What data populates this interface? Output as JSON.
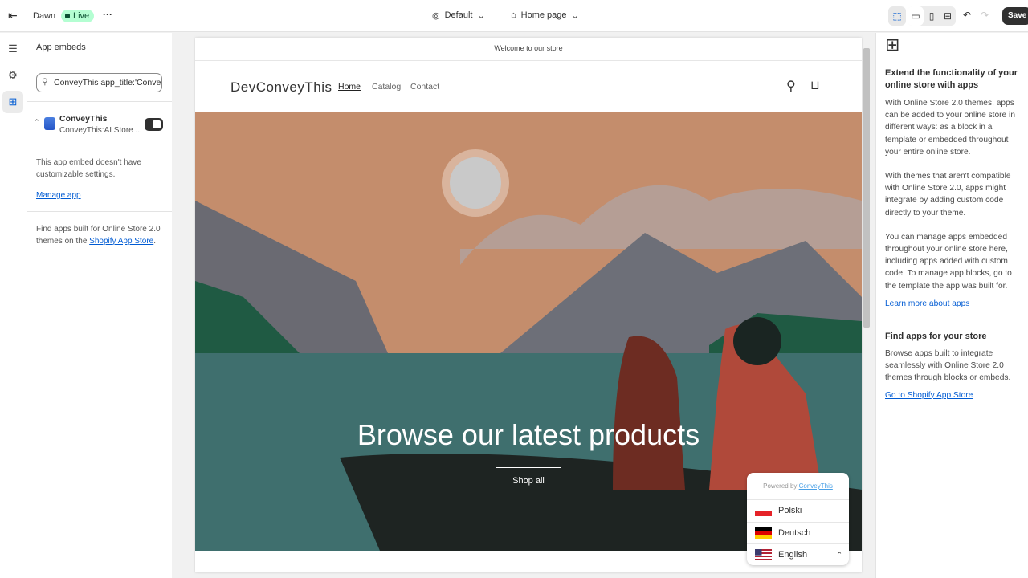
{
  "topbar": {
    "theme_name": "Dawn",
    "status": "Live",
    "more": "···",
    "template_select": "Default",
    "page_select": "Home page",
    "save": "Save"
  },
  "sidebar": {
    "title": "App embeds",
    "search_value": "ConveyThis app_title:'ConveyThis'",
    "app": {
      "name": "ConveyThis",
      "subtitle": "ConveyThis:AI Store ...",
      "enabled": true
    },
    "no_settings": "This app embed doesn't have customizable settings.",
    "manage_link": "Manage app",
    "footer_prefix": "Find apps built for Online Store 2.0 themes on the ",
    "footer_link": "Shopify App Store",
    "footer_suffix": "."
  },
  "store": {
    "announcement": "Welcome to our store",
    "logo": "DevConveyThis",
    "nav": [
      "Home",
      "Catalog",
      "Contact"
    ],
    "hero_heading": "Browse our latest products",
    "hero_button": "Shop all"
  },
  "language_switcher": {
    "powered_prefix": "Powered by ",
    "powered_link": "ConveyThis",
    "languages": [
      "Polski",
      "Deutsch",
      "English"
    ],
    "current": "English"
  },
  "right_panel": {
    "heading1": "Extend the functionality of your online store with apps",
    "p1": "With Online Store 2.0 themes, apps can be added to your online store in different ways: as a block in a template or embedded throughout your entire online store.",
    "p2": "With themes that aren't compatible with Online Store 2.0, apps might integrate by adding custom code directly to your theme.",
    "p3": "You can manage apps embedded throughout your online store here, including apps added with custom code. To manage app blocks, go to the template the app was built for.",
    "link1": "Learn more about apps",
    "heading2": "Find apps for your store",
    "p4": "Browse apps built to integrate seamlessly with Online Store 2.0 themes through blocks or embeds.",
    "link2": "Go to Shopify App Store"
  }
}
